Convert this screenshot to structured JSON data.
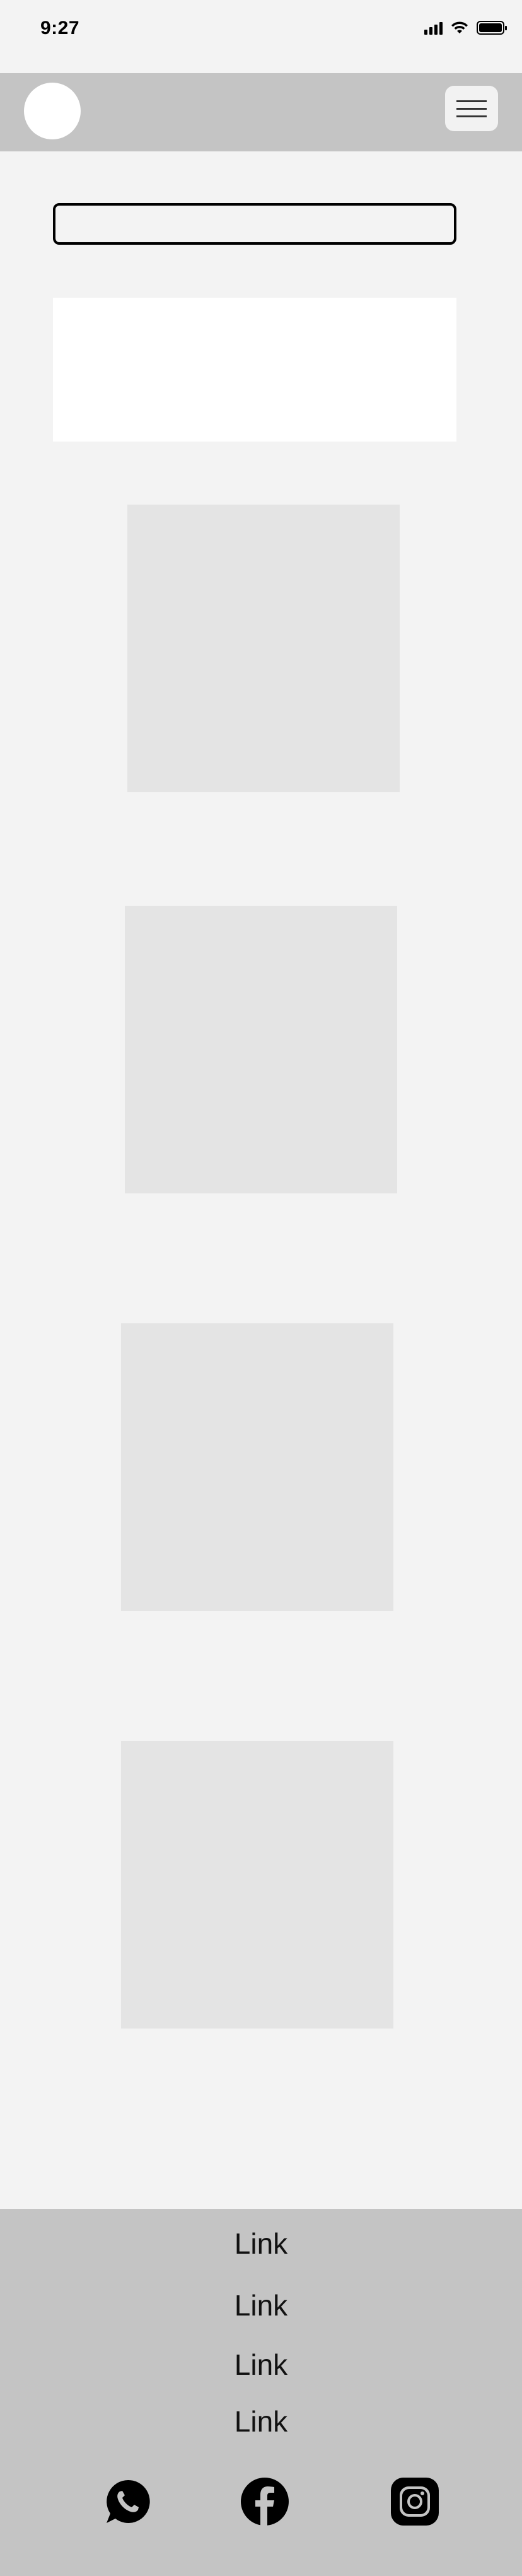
{
  "status_bar": {
    "time": "9:27",
    "icons": [
      "signal-icon",
      "wifi-icon",
      "battery-icon"
    ],
    "battery_level": 1.0
  },
  "header": {
    "logo": "logo",
    "menu_icon": "hamburger-menu-icon"
  },
  "search": {
    "value": "",
    "placeholder": ""
  },
  "footer": {
    "links": [
      "Link",
      "Link",
      "Link",
      "Link"
    ],
    "social": [
      "whatsapp-icon",
      "facebook-icon",
      "instagram-icon"
    ]
  },
  "colors": {
    "background": "#f3f3f3",
    "header": "#c4c4c4",
    "footer": "#c4c4c4",
    "placeholder": "#e4e4e4",
    "banner": "#ffffff"
  }
}
